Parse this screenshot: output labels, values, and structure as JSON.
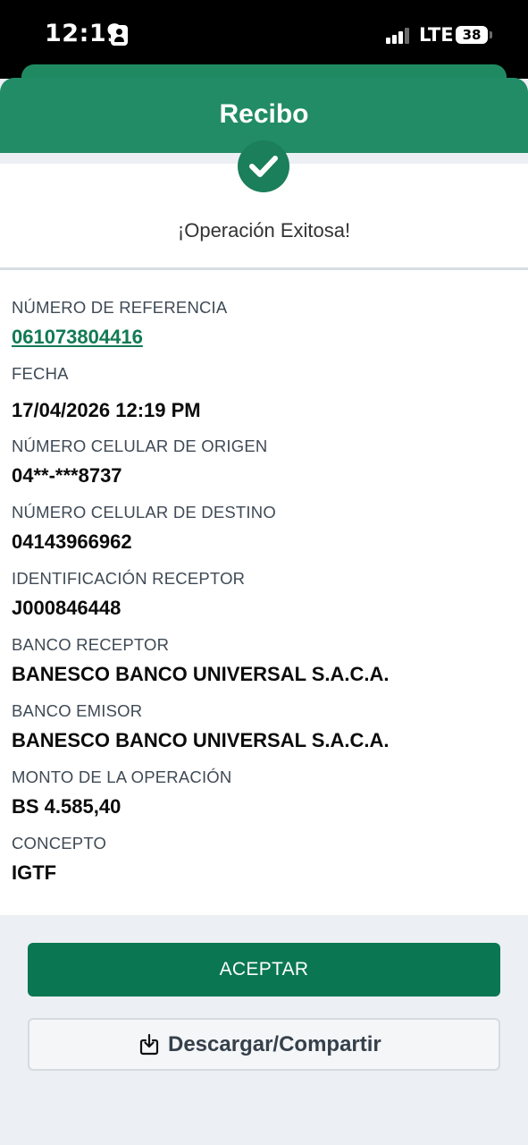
{
  "status_bar": {
    "time": "12:19",
    "network": "LTE",
    "battery": "38"
  },
  "header": {
    "title": "Recibo"
  },
  "result": {
    "message": "¡Operación Exitosa!"
  },
  "details": {
    "reference_label": "NÚMERO DE REFERENCIA",
    "reference_value": "061073804416",
    "date_label": "FECHA",
    "date_value": "17/04/2026 12:19 PM",
    "origin_label": "NÚMERO CELULAR DE ORIGEN",
    "origin_value": "04**-***8737",
    "destination_label": "NÚMERO CELULAR DE DESTINO",
    "destination_value": "04143966962",
    "receiver_id_label": "IDENTIFICACIÓN RECEPTOR",
    "receiver_id_value": "J000846448",
    "receiver_bank_label": "BANCO RECEPTOR",
    "receiver_bank_value": "BANESCO BANCO UNIVERSAL S.A.C.A.",
    "issuer_bank_label": "BANCO EMISOR",
    "issuer_bank_value": "BANESCO BANCO UNIVERSAL S.A.C.A.",
    "amount_label": "MONTO DE LA OPERACIÓN",
    "amount_value": "BS 4.585,40",
    "concept_label": "CONCEPTO",
    "concept_value": "IGTF"
  },
  "actions": {
    "accept_label": "ACEPTAR",
    "download_label": "Descargar/Compartir"
  },
  "colors": {
    "brand_green": "#218c66",
    "button_green": "#0a7752",
    "link_green": "#127a55"
  },
  "icons": {
    "success": "check-circle-icon",
    "download": "download-share-icon"
  }
}
